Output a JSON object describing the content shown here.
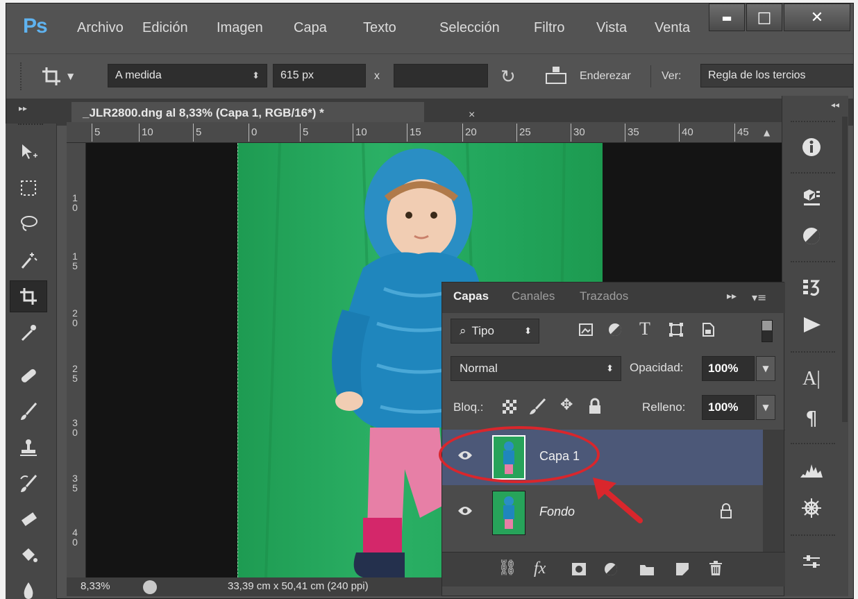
{
  "app": {
    "logo": "Ps",
    "menu": [
      "Archivo",
      "Edición",
      "Imagen",
      "Capa",
      "Texto",
      "Selección",
      "Filtro",
      "Vista",
      "Venta"
    ],
    "window_controls": {
      "minimize": "▬",
      "maximize": "□",
      "close": "✕"
    }
  },
  "options_bar": {
    "preset": "A medida",
    "width": "615 px",
    "x_sep": "x",
    "height": "",
    "straighten_label": "Enderezar",
    "view_label": "Ver:",
    "view_value": "Regla de los tercios"
  },
  "document": {
    "tab_title": "_JLR2800.dng al 8,33% (Capa 1, RGB/16*) *",
    "tab_close": "×"
  },
  "ruler_top": [
    "5",
    "10",
    "5",
    "0",
    "5",
    "10",
    "15",
    "20",
    "25",
    "30",
    "35",
    "40",
    "45"
  ],
  "ruler_left": [
    [
      "1",
      "0"
    ],
    [
      "1",
      "5"
    ],
    [
      "2",
      "0"
    ],
    [
      "2",
      "5"
    ],
    [
      "3",
      "0"
    ],
    [
      "3",
      "5"
    ],
    [
      "4",
      "0"
    ]
  ],
  "status": {
    "zoom": "8,33%",
    "doc_size": "33,39 cm x 50,41 cm (240 ppi)"
  },
  "tools": [
    "move-tool-icon",
    "marquee-tool-icon",
    "lasso-tool-icon",
    "magic-wand-tool-icon",
    "crop-tool-icon",
    "eyedropper-tool-icon",
    "healing-brush-tool-icon",
    "brush-tool-icon",
    "clone-stamp-tool-icon",
    "history-brush-tool-icon",
    "eraser-tool-icon",
    "paint-bucket-tool-icon",
    "blur-tool-icon"
  ],
  "layers_panel": {
    "tabs": [
      "Capas",
      "Canales",
      "Trazados"
    ],
    "filter_kind": "Tipo",
    "blend_mode": "Normal",
    "opacity_label": "Opacidad:",
    "opacity_value": "100%",
    "lock_label": "Bloq.:",
    "fill_label": "Relleno:",
    "fill_value": "100%",
    "layers": [
      {
        "name": "Capa 1",
        "selected": true,
        "locked": false
      },
      {
        "name": "Fondo",
        "selected": false,
        "locked": true
      }
    ],
    "bottom_icons": [
      "link-layers-icon",
      "fx-icon",
      "mask-icon",
      "adjustment-icon",
      "group-folder-icon",
      "new-layer-icon",
      "trash-icon"
    ],
    "fx_label": "fx"
  },
  "colors": {
    "accent_logo": "#5fb3f0",
    "selected_layer": "#4c5878",
    "annotation_red": "#d9262c",
    "green_screen": "#27a35a"
  }
}
